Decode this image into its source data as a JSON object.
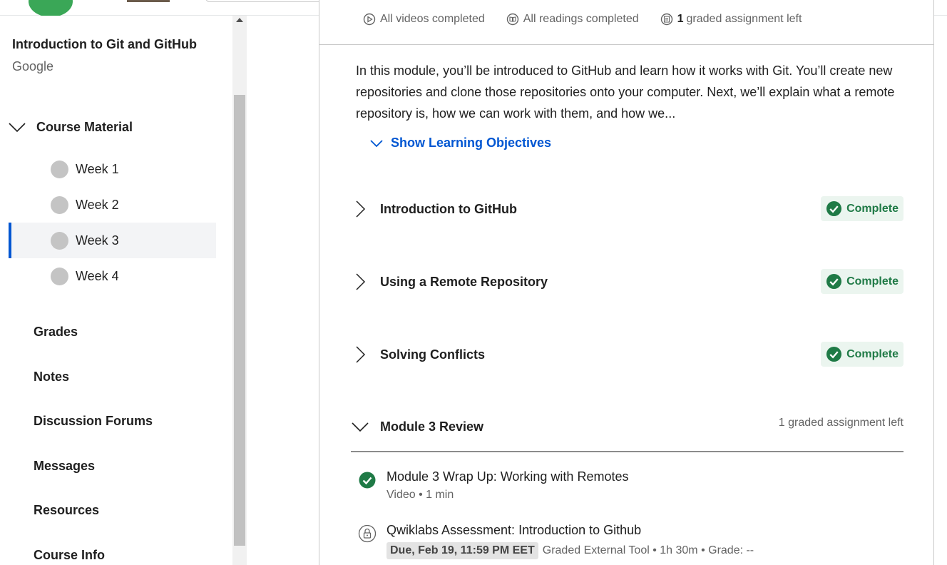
{
  "colors": {
    "primary": "#0056d2",
    "success": "#1f7a46",
    "success_bg": "#ebf5ef",
    "text": "#1f1f1f",
    "muted": "#636363"
  },
  "course": {
    "title": "Introduction to Git and GitHub",
    "partner": "Google"
  },
  "sidebar": {
    "section_label": "Course Material",
    "weeks": [
      {
        "label": "Week 1"
      },
      {
        "label": "Week 2"
      },
      {
        "label": "Week 3",
        "active": true
      },
      {
        "label": "Week 4"
      }
    ],
    "links": [
      "Grades",
      "Notes",
      "Discussion Forums",
      "Messages",
      "Resources",
      "Course Info"
    ]
  },
  "module": {
    "stats": {
      "videos": "All videos completed",
      "readings": "All readings completed",
      "graded_count": "1",
      "graded_label": "graded assignment left"
    },
    "description": "In this module, you’ll be introduced to GitHub and learn how it works with Git. You’ll create new repositories and clone those repositories onto your computer. Next, we’ll explain what a remote repository is, how we can work with them, and how we...",
    "objectives_label": "Show Learning Objectives",
    "lessons": [
      {
        "title": "Introduction to GitHub",
        "status": "Complete"
      },
      {
        "title": "Using a Remote Repository",
        "status": "Complete"
      },
      {
        "title": "Solving Conflicts",
        "status": "Complete"
      }
    ],
    "review": {
      "title": "Module 3 Review",
      "status": "1 graded assignment left",
      "items": [
        {
          "title": "Module 3 Wrap Up: Working with Remotes",
          "meta": "Video • 1 min",
          "icon": "check-circle-icon"
        },
        {
          "title": "Qwiklabs Assessment: Introduction to Github",
          "due": "Due, Feb 19, 11:59 PM EET",
          "meta": "Graded External Tool • 1h 30m • Grade: --",
          "icon": "lock-icon"
        }
      ]
    }
  }
}
